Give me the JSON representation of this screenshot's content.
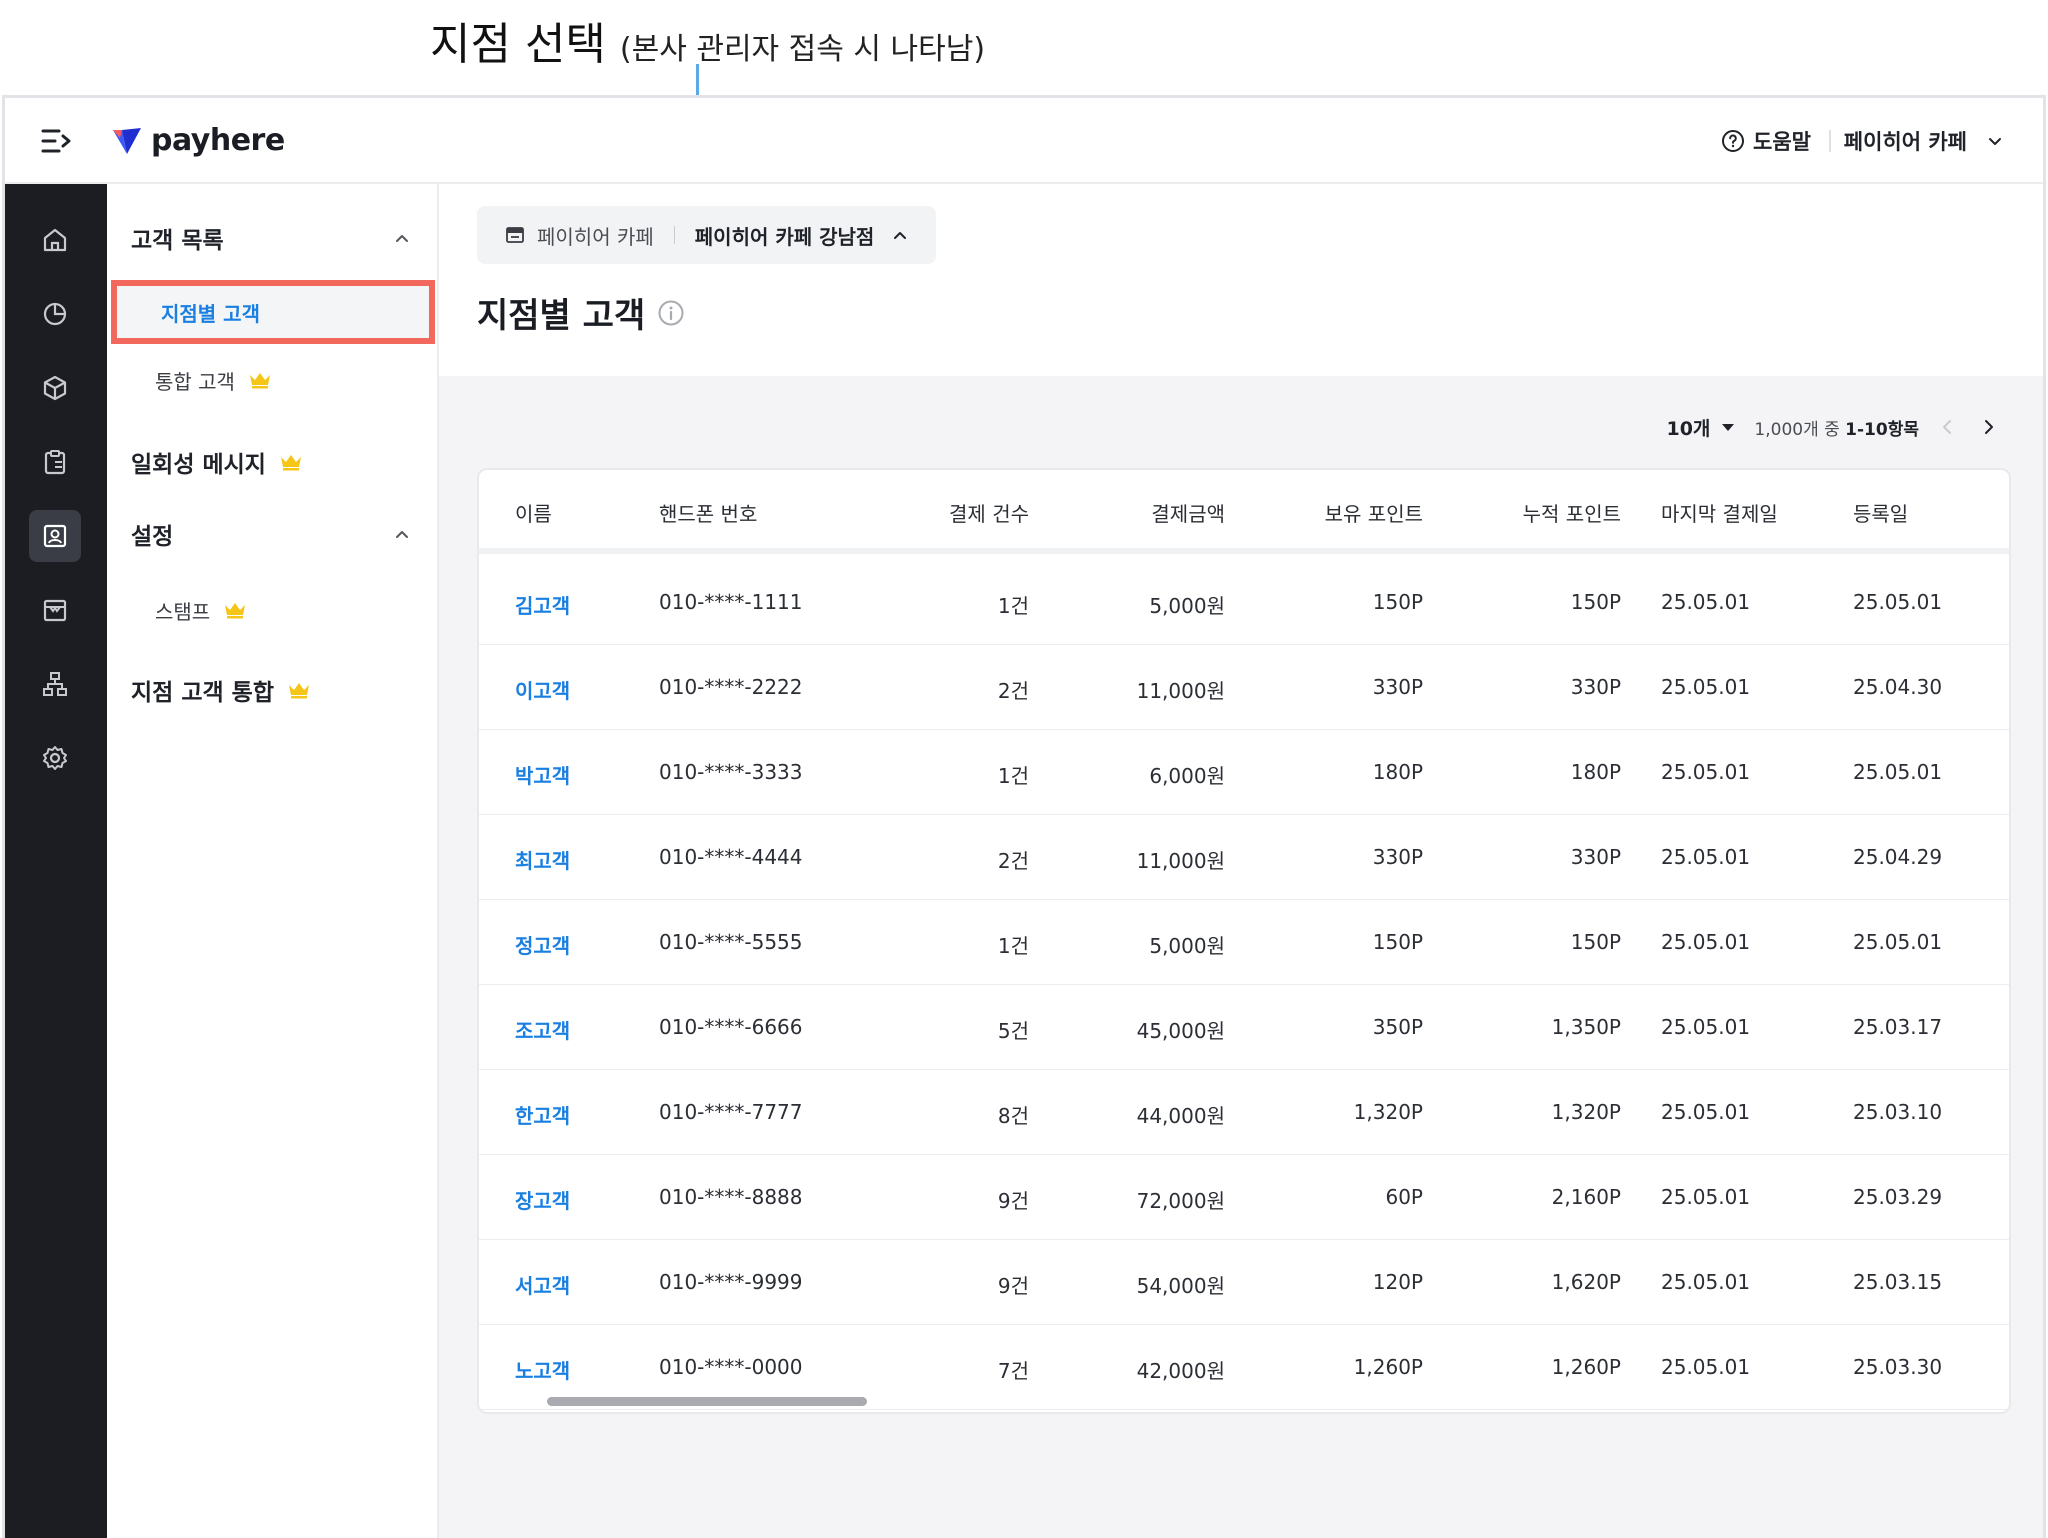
{
  "annotation": {
    "title": "지점 선택",
    "subtitle": "(본사 관리자 접속 시 나타남)"
  },
  "topbar": {
    "logo_text": "payhere",
    "help_label": "도움말",
    "store_label": "페이히어 카페"
  },
  "submenu": {
    "customer_list": "고객 목록",
    "branch_customers": "지점별 고객",
    "integrated_customers": "통합 고객",
    "one_time_message": "일회성 메시지",
    "settings": "설정",
    "stamp": "스탬프",
    "branch_customer_merge": "지점 고객 통합"
  },
  "branch_selector": {
    "parent": "페이히어 카페",
    "current": "페이히어 카페 강남점"
  },
  "page": {
    "title": "지점별 고객"
  },
  "pager": {
    "page_size": "10개",
    "info_prefix": "1,000개 중 ",
    "info_range": "1-10항목"
  },
  "table": {
    "columns": [
      "이름",
      "핸드폰 번호",
      "결제 건수",
      "결제금액",
      "보유 포인트",
      "누적 포인트",
      "마지막 결제일",
      "등록일"
    ],
    "rows": [
      [
        "김고객",
        "010-****-1111",
        "1건",
        "5,000원",
        "150P",
        "150P",
        "25.05.01",
        "25.05.01"
      ],
      [
        "이고객",
        "010-****-2222",
        "2건",
        "11,000원",
        "330P",
        "330P",
        "25.05.01",
        "25.04.30"
      ],
      [
        "박고객",
        "010-****-3333",
        "1건",
        "6,000원",
        "180P",
        "180P",
        "25.05.01",
        "25.05.01"
      ],
      [
        "최고객",
        "010-****-4444",
        "2건",
        "11,000원",
        "330P",
        "330P",
        "25.05.01",
        "25.04.29"
      ],
      [
        "정고객",
        "010-****-5555",
        "1건",
        "5,000원",
        "150P",
        "150P",
        "25.05.01",
        "25.05.01"
      ],
      [
        "조고객",
        "010-****-6666",
        "5건",
        "45,000원",
        "350P",
        "1,350P",
        "25.05.01",
        "25.03.17"
      ],
      [
        "한고객",
        "010-****-7777",
        "8건",
        "44,000원",
        "1,320P",
        "1,320P",
        "25.05.01",
        "25.03.10"
      ],
      [
        "장고객",
        "010-****-8888",
        "9건",
        "72,000원",
        "60P",
        "2,160P",
        "25.05.01",
        "25.03.29"
      ],
      [
        "서고객",
        "010-****-9999",
        "9건",
        "54,000원",
        "120P",
        "1,620P",
        "25.05.01",
        "25.03.15"
      ],
      [
        "노고객",
        "010-****-0000",
        "7건",
        "42,000원",
        "1,260P",
        "1,260P",
        "25.05.01",
        "25.03.30"
      ]
    ]
  },
  "colors": {
    "accent_blue": "#1a7fe0",
    "highlight_red": "#f2685c",
    "crown_yellow": "#f5c518",
    "rail_bg": "#1b1d22",
    "annotation_line": "#5ba9e6"
  },
  "icons": {
    "rail": [
      "home-icon",
      "chart-pie-icon",
      "box-icon",
      "clipboard-icon",
      "customer-card-icon",
      "store-icon",
      "org-chart-icon",
      "gear-icon"
    ]
  }
}
